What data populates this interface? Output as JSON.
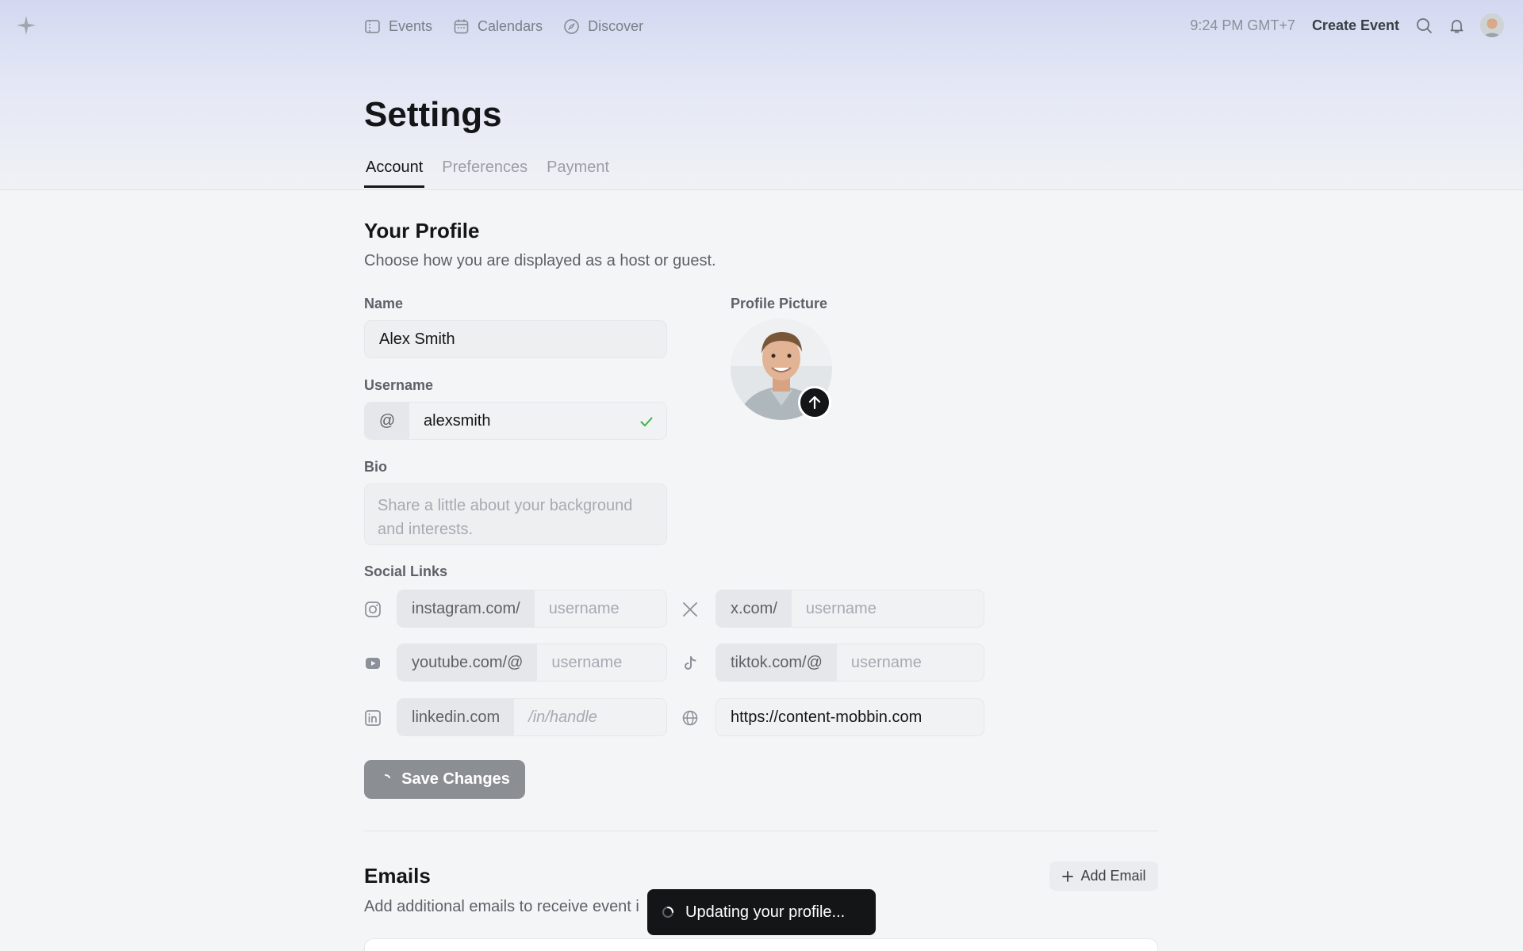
{
  "nav": {
    "items": [
      {
        "label": "Events",
        "icon": "ticket-icon"
      },
      {
        "label": "Calendars",
        "icon": "calendar-icon"
      },
      {
        "label": "Discover",
        "icon": "compass-icon"
      }
    ],
    "time": "9:24 PM GMT+7",
    "create_event": "Create Event"
  },
  "page": {
    "title": "Settings",
    "tabs": [
      "Account",
      "Preferences",
      "Payment"
    ]
  },
  "profile": {
    "title": "Your Profile",
    "subtitle": "Choose how you are displayed as a host or guest.",
    "name_label": "Name",
    "name_value": "Alex Smith",
    "username_label": "Username",
    "username_prefix": "@",
    "username_value": "alexsmith",
    "bio_label": "Bio",
    "bio_placeholder": "Share a little about your background and interests.",
    "picture_label": "Profile Picture"
  },
  "social": {
    "label": "Social Links",
    "links": [
      {
        "icon": "instagram-icon",
        "prefix": "instagram.com/",
        "placeholder": "username",
        "value": ""
      },
      {
        "icon": "x-icon",
        "prefix": "x.com/",
        "placeholder": "username",
        "value": ""
      },
      {
        "icon": "youtube-icon",
        "prefix": "youtube.com/@",
        "placeholder": "username",
        "value": ""
      },
      {
        "icon": "tiktok-icon",
        "prefix": "tiktok.com/@",
        "placeholder": "username",
        "value": ""
      },
      {
        "icon": "linkedin-icon",
        "prefix": "linkedin.com",
        "placeholder": "/in/handle",
        "value": ""
      },
      {
        "icon": "globe-icon",
        "prefix": "",
        "placeholder": "",
        "value": "https://content-mobbin.com"
      }
    ]
  },
  "save_label": "Save Changes",
  "emails": {
    "title": "Emails",
    "subtitle": "Add additional emails to receive event i",
    "add_label": "Add Email"
  },
  "toast": "Updating your profile...",
  "colors": {
    "accent": "#131517",
    "success": "#3bb34a",
    "background": "#f4f5f6"
  }
}
